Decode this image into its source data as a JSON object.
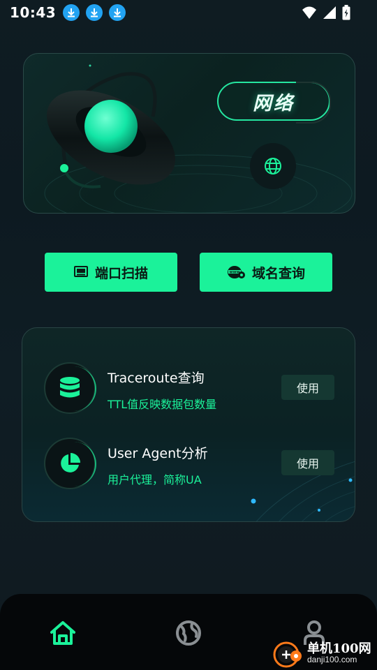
{
  "status_bar": {
    "time": "10:43",
    "download_icons": [
      "download-icon",
      "download-icon",
      "download-icon"
    ],
    "right_icons": [
      "wifi-icon",
      "signal-icon",
      "battery-icon"
    ]
  },
  "hero": {
    "title": "网络",
    "icon": "globe-icon"
  },
  "actions": [
    {
      "label": "端口扫描",
      "icon": "monitor-icon"
    },
    {
      "label": "域名查询",
      "icon": "www-icon"
    }
  ],
  "tools": [
    {
      "title": "Traceroute查询",
      "subtitle": "TTL值反映数据包数量",
      "button": "使用",
      "icon": "database-icon"
    },
    {
      "title": "User Agent分析",
      "subtitle": "用户代理，简称UA",
      "button": "使用",
      "icon": "pie-chart-icon"
    }
  ],
  "nav": [
    {
      "name": "home",
      "icon": "home-icon",
      "active": true
    },
    {
      "name": "network",
      "icon": "globe-icon",
      "active": false
    },
    {
      "name": "profile",
      "icon": "user-icon",
      "active": false
    }
  ],
  "watermark": {
    "cn": "单机100网",
    "en": "danji100.com"
  },
  "colors": {
    "accent": "#1bf29a",
    "background": "#0f1c22",
    "nav_bg": "#050709"
  }
}
